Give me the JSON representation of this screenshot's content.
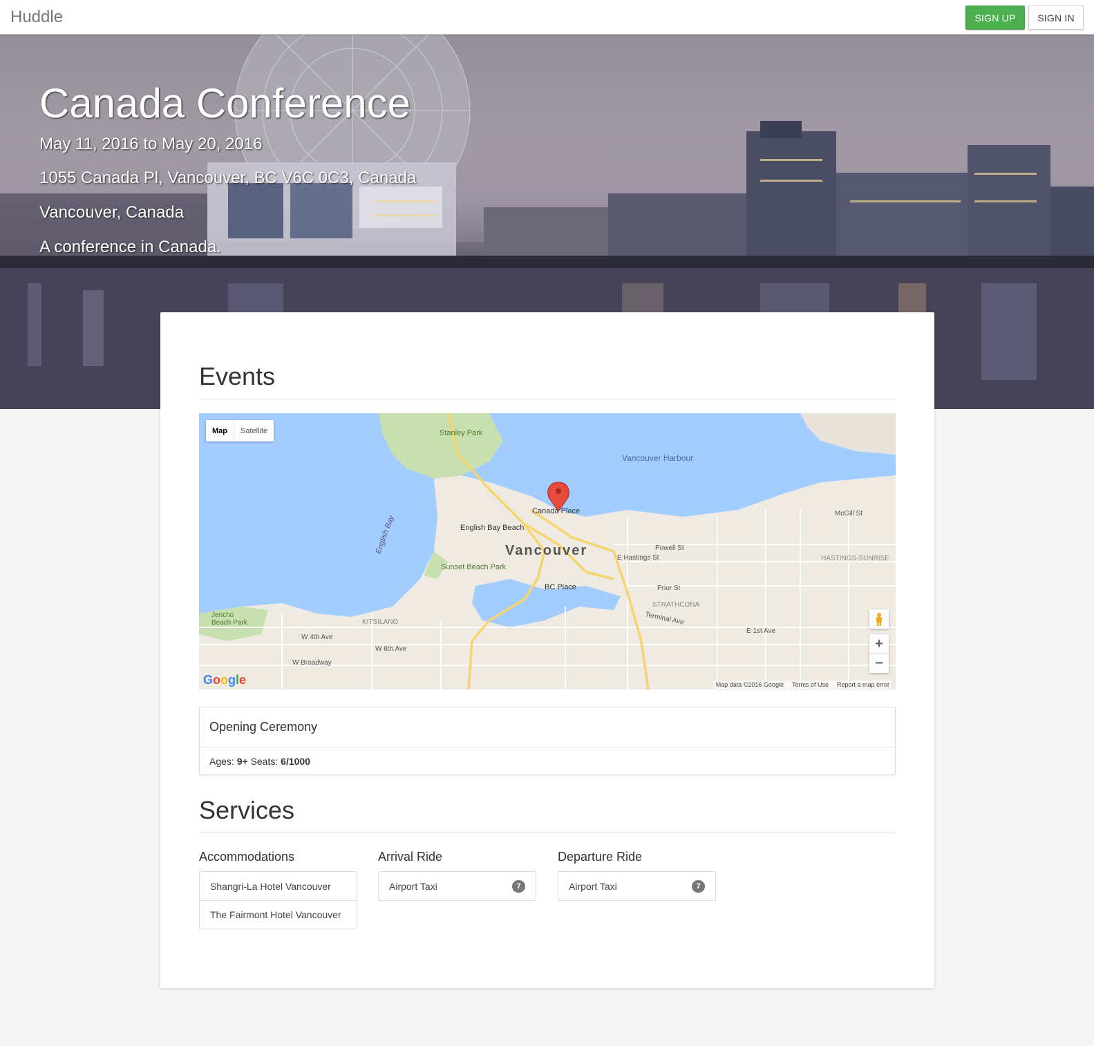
{
  "navbar": {
    "brand": "Huddle",
    "signup_label": "SIGN UP",
    "signin_label": "SIGN IN"
  },
  "hero": {
    "title": "Canada Conference",
    "dates": "May 11, 2016 to May 20, 2016",
    "address": "1055 Canada Pl, Vancouver, BC V6C 0C3, Canada",
    "city": "Vancouver, Canada",
    "description": "A conference in Canada."
  },
  "events": {
    "heading": "Events",
    "map": {
      "type_map": "Map",
      "type_satellite": "Satellite",
      "google": "Google",
      "map_data": "Map data ©2016 Google",
      "terms": "Terms of Use",
      "report": "Report a map error",
      "labels": {
        "vancouver": "Vancouver",
        "canada_place": "Canada Place",
        "english_bay_beach": "English Bay Beach",
        "english_bay": "English Bay",
        "stanley_park": "Stanley Park",
        "vancouver_harbour": "Vancouver Harbour",
        "sunset_beach_park": "Sunset Beach Park",
        "bc_place": "BC Place",
        "jericho_beach_park": "Jericho Beach Park",
        "kitsilano": "KITSILANO",
        "strathcona": "STRATHCONA",
        "hastings_sunrise": "HASTINGS-SUNRISE",
        "w_broadway": "W Broadway",
        "e_hastings": "E Hastings St",
        "powell": "Powell St",
        "prior": "Prior St",
        "terminal": "Terminal Ave",
        "w_4th": "W 4th Ave",
        "w_6th": "W 6th Ave",
        "e_1st": "E 1st Ave",
        "mcgill": "McGill St"
      }
    },
    "event": {
      "name": "Opening Ceremony",
      "ages_label": "Ages:",
      "ages_value": "9+",
      "seats_label": "Seats:",
      "seats_value": "6/1000"
    }
  },
  "services": {
    "heading": "Services",
    "accommodations": {
      "title": "Accommodations",
      "items": [
        "Shangri-La Hotel Vancouver",
        "The Fairmont Hotel Vancouver"
      ]
    },
    "arrival": {
      "title": "Arrival Ride",
      "item": "Airport Taxi",
      "count": "7"
    },
    "departure": {
      "title": "Departure Ride",
      "item": "Airport Taxi",
      "count": "7"
    }
  }
}
